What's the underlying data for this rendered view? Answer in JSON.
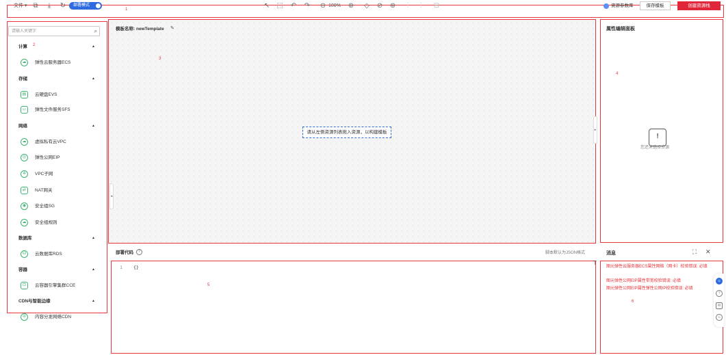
{
  "toolbar": {
    "file_menu": "文件",
    "mode_toggle": "部署模式",
    "zoom": "100%",
    "resource_library": "资源参数库",
    "save_template": "保存模板",
    "create_stack": "创建资源栈",
    "area_number": "1"
  },
  "left_panel": {
    "search_placeholder": "请输入关键字",
    "area_number": "2",
    "categories": [
      {
        "name": "计算",
        "items": [
          {
            "label": "弹性云服务器ECS",
            "icon": "cloud-server-icon"
          }
        ]
      },
      {
        "name": "存储",
        "items": [
          {
            "label": "云硬盘EVS",
            "icon": "disk-icon"
          },
          {
            "label": "弹性文件服务SFS",
            "icon": "folder-icon"
          }
        ]
      },
      {
        "name": "网络",
        "items": [
          {
            "label": "虚拟私有云VPC",
            "icon": "cloud-icon"
          },
          {
            "label": "弹性公网EIP",
            "icon": "eip-icon"
          },
          {
            "label": "VPC子网",
            "icon": "subnet-icon"
          },
          {
            "label": "NAT网关",
            "icon": "nat-icon"
          },
          {
            "label": "安全组SG",
            "icon": "security-group-icon"
          },
          {
            "label": "安全组规则",
            "icon": "security-rule-icon"
          }
        ]
      },
      {
        "name": "数据库",
        "items": [
          {
            "label": "云数据库RDS",
            "icon": "database-icon"
          }
        ]
      },
      {
        "name": "容器",
        "items": [
          {
            "label": "云容器引擎集群CCE",
            "icon": "container-icon"
          }
        ]
      },
      {
        "name": "CDN与智能边缘",
        "items": [
          {
            "label": "内容分发网络CDN",
            "icon": "cdn-icon"
          }
        ]
      }
    ]
  },
  "canvas": {
    "template_label": "模板名称:",
    "template_name": "newTemplate",
    "hint": "请从左侧资源列表拖入资源，以构建模板",
    "area_number": "3"
  },
  "property_panel": {
    "title": "属性编辑面板",
    "empty_text": "您还未选择资源",
    "area_number": "4"
  },
  "code_panel": {
    "title": "部署代码",
    "note": "脚本默认为JSON格式",
    "line_number": "1",
    "content": "{}",
    "area_number": "5"
  },
  "message_panel": {
    "title": "消息",
    "area_number": "6",
    "messages": [
      "图元弹性云服务器ECS属性网络（网卡）校验错误: 必填",
      "图元弹性公网EIP属性带宽校验错误: 必填",
      "图元弹性公网EIP属性弹性公网IP校验错误: 必填"
    ]
  },
  "colors": {
    "accent_blue": "#2f6bde",
    "primary_red": "#e2263a",
    "annotation_red": "#e8343a",
    "resource_green": "#3cb371"
  }
}
